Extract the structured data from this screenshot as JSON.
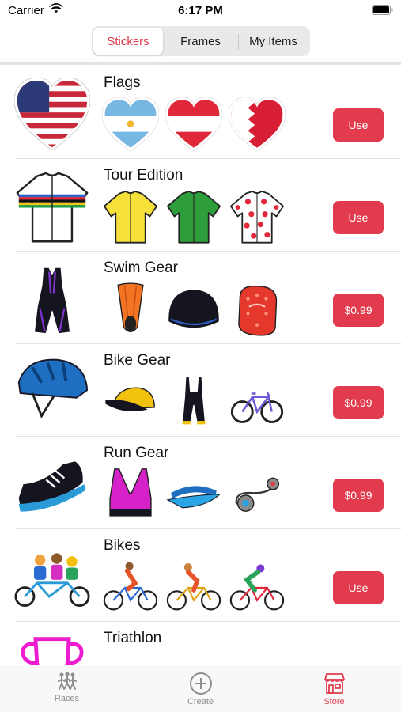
{
  "status_bar": {
    "carrier": "Carrier",
    "time": "6:17 PM"
  },
  "segments": [
    {
      "label": "Stickers",
      "active": true
    },
    {
      "label": "Frames",
      "active": false
    },
    {
      "label": "My Items",
      "active": false
    }
  ],
  "rows": [
    {
      "title": "Flags",
      "button": "Use",
      "main_icon": "usa-heart-flag-icon",
      "thumbs": [
        "argentina-heart-icon",
        "austria-heart-icon",
        "bahrain-heart-icon"
      ]
    },
    {
      "title": "Tour Edition",
      "button": "Use",
      "main_icon": "world-champion-jersey-icon",
      "thumbs": [
        "yellow-jersey-icon",
        "green-jersey-icon",
        "polka-dot-jersey-icon"
      ]
    },
    {
      "title": "Swim Gear",
      "button": "$0.99",
      "main_icon": "swimsuit-icon",
      "thumbs": [
        "swim-fin-icon",
        "swim-cap-icon",
        "hand-paddle-icon"
      ]
    },
    {
      "title": "Bike Gear",
      "button": "$0.99",
      "main_icon": "bike-helmet-icon",
      "thumbs": [
        "cycling-cap-icon",
        "bib-shorts-icon",
        "road-bike-icon"
      ]
    },
    {
      "title": "Run Gear",
      "button": "$0.99",
      "main_icon": "running-shoe-icon",
      "thumbs": [
        "sports-bra-icon",
        "visor-icon",
        "earphones-icon"
      ]
    },
    {
      "title": "Bikes",
      "button": "Use",
      "main_icon": "tandem-bike-icon",
      "thumbs": [
        "cyclist-blue-icon",
        "cyclist-yellow-icon",
        "cyclist-red-icon"
      ]
    },
    {
      "title": "Triathlon",
      "button": "",
      "main_icon": "trophy-icon",
      "thumbs": [
        "triathlon-pink-icon",
        "triathlon-teal-icon",
        "triathlon-cyan-icon"
      ]
    }
  ],
  "tabs": [
    {
      "label": "Races",
      "icon": "runners-icon",
      "active": false
    },
    {
      "label": "Create",
      "icon": "plus-circle-icon",
      "active": false
    },
    {
      "label": "Store",
      "icon": "storefront-icon",
      "active": true
    }
  ],
  "colors": {
    "accent": "#e23b4d",
    "separator": "#e3e3e6",
    "inactive_tab": "#8e8e93"
  }
}
